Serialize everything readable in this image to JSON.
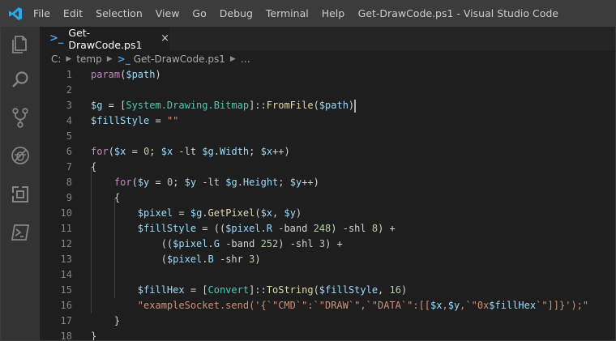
{
  "titlebar": {
    "menu": [
      "File",
      "Edit",
      "Selection",
      "View",
      "Go",
      "Debug",
      "Terminal",
      "Help"
    ],
    "title": "Get-DrawCode.ps1 - Visual Studio Code"
  },
  "activity_bar": {
    "icons": [
      "explorer-icon",
      "search-icon",
      "source-control-icon",
      "debug-icon",
      "extensions-icon",
      "powershell-icon"
    ]
  },
  "tabs": [
    {
      "label": "Get-DrawCode.ps1",
      "close": "×"
    }
  ],
  "breadcrumb": {
    "parts": [
      "C:",
      "temp",
      "Get-DrawCode.ps1",
      "…"
    ]
  },
  "editor": {
    "line_numbers": [
      "1",
      "2",
      "3",
      "4",
      "5",
      "6",
      "7",
      "8",
      "9",
      "10",
      "11",
      "12",
      "13",
      "14",
      "15",
      "16",
      "17",
      "18"
    ],
    "lines": [
      [
        [
          "kw",
          "param"
        ],
        [
          "op",
          "("
        ],
        [
          "var",
          "$path"
        ],
        [
          "op",
          ")"
        ]
      ],
      [],
      [
        [
          "var",
          "$g"
        ],
        [
          "op",
          " = ["
        ],
        [
          "ty",
          "System.Drawing.Bitmap"
        ],
        [
          "op",
          "]::"
        ],
        [
          "fn",
          "FromFile"
        ],
        [
          "op",
          "("
        ],
        [
          "var",
          "$path"
        ],
        [
          "op",
          ")"
        ]
      ],
      [
        [
          "var",
          "$fillStyle"
        ],
        [
          "op",
          " = "
        ],
        [
          "str",
          "\"\""
        ]
      ],
      [],
      [
        [
          "kw",
          "for"
        ],
        [
          "op",
          "("
        ],
        [
          "var",
          "$x"
        ],
        [
          "op",
          " = "
        ],
        [
          "num",
          "0"
        ],
        [
          "op",
          "; "
        ],
        [
          "var",
          "$x"
        ],
        [
          "op",
          " -lt "
        ],
        [
          "var",
          "$g"
        ],
        [
          "op",
          "."
        ],
        [
          "var",
          "Width"
        ],
        [
          "op",
          "; "
        ],
        [
          "var",
          "$x"
        ],
        [
          "op",
          "++)"
        ]
      ],
      [
        [
          "op",
          "{"
        ]
      ],
      [
        [
          "op",
          "    "
        ],
        [
          "kw",
          "for"
        ],
        [
          "op",
          "("
        ],
        [
          "var",
          "$y"
        ],
        [
          "op",
          " = "
        ],
        [
          "num",
          "0"
        ],
        [
          "op",
          "; "
        ],
        [
          "var",
          "$y"
        ],
        [
          "op",
          " -lt "
        ],
        [
          "var",
          "$g"
        ],
        [
          "op",
          "."
        ],
        [
          "var",
          "Height"
        ],
        [
          "op",
          "; "
        ],
        [
          "var",
          "$y"
        ],
        [
          "op",
          "++)"
        ]
      ],
      [
        [
          "op",
          "    {"
        ]
      ],
      [
        [
          "op",
          "        "
        ],
        [
          "var",
          "$pixel"
        ],
        [
          "op",
          " = "
        ],
        [
          "var",
          "$g"
        ],
        [
          "op",
          "."
        ],
        [
          "fn",
          "GetPixel"
        ],
        [
          "op",
          "("
        ],
        [
          "var",
          "$x"
        ],
        [
          "op",
          ", "
        ],
        [
          "var",
          "$y"
        ],
        [
          "op",
          ")"
        ]
      ],
      [
        [
          "op",
          "        "
        ],
        [
          "var",
          "$fillStyle"
        ],
        [
          "op",
          " = (("
        ],
        [
          "var",
          "$pixel"
        ],
        [
          "op",
          "."
        ],
        [
          "var",
          "R"
        ],
        [
          "op",
          " -band "
        ],
        [
          "num",
          "248"
        ],
        [
          "op",
          ") -shl "
        ],
        [
          "num",
          "8"
        ],
        [
          "op",
          ") +"
        ]
      ],
      [
        [
          "op",
          "            (("
        ],
        [
          "var",
          "$pixel"
        ],
        [
          "op",
          "."
        ],
        [
          "var",
          "G"
        ],
        [
          "op",
          " -band "
        ],
        [
          "num",
          "252"
        ],
        [
          "op",
          ") -shl "
        ],
        [
          "num",
          "3"
        ],
        [
          "op",
          ") +"
        ]
      ],
      [
        [
          "op",
          "            ("
        ],
        [
          "var",
          "$pixel"
        ],
        [
          "op",
          "."
        ],
        [
          "var",
          "B"
        ],
        [
          "op",
          " -shr "
        ],
        [
          "num",
          "3"
        ],
        [
          "op",
          ")"
        ]
      ],
      [],
      [
        [
          "op",
          "        "
        ],
        [
          "var",
          "$fillHex"
        ],
        [
          "op",
          " = ["
        ],
        [
          "ty",
          "Convert"
        ],
        [
          "op",
          "]::"
        ],
        [
          "fn",
          "ToString"
        ],
        [
          "op",
          "("
        ],
        [
          "var",
          "$fillStyle"
        ],
        [
          "op",
          ", "
        ],
        [
          "num",
          "16"
        ],
        [
          "op",
          ")"
        ]
      ],
      [
        [
          "op",
          "        "
        ],
        [
          "str",
          "\"exampleSocket.send('{`\"CMD`\":`\"DRAW`\",`\"DATA`\":[["
        ],
        [
          "var",
          "$x"
        ],
        [
          "str",
          ","
        ],
        [
          "var",
          "$y"
        ],
        [
          "str",
          ",`\"0x"
        ],
        [
          "var",
          "$fillHex"
        ],
        [
          "str",
          "`\"]]}');\""
        ]
      ],
      [
        [
          "op",
          "    }"
        ]
      ],
      [
        [
          "op",
          "}"
        ]
      ]
    ]
  }
}
